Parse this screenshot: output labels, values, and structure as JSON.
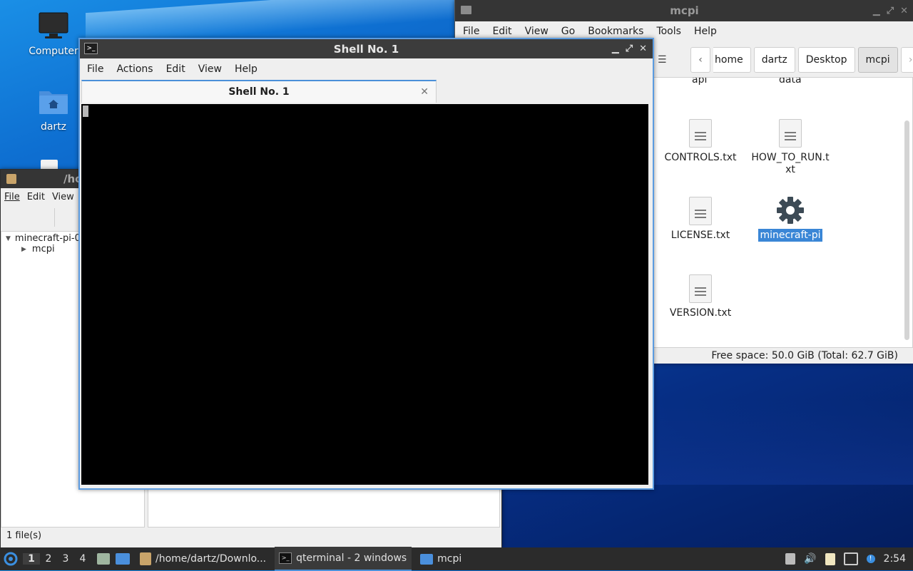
{
  "desktop": {
    "icons": [
      {
        "label": "Computer",
        "icon": "monitor-icon"
      },
      {
        "label": "dartz",
        "icon": "home-folder-icon"
      }
    ]
  },
  "archive_window": {
    "title": "/ho",
    "menu": [
      "File",
      "Edit",
      "View"
    ],
    "tree": [
      {
        "label": "minecraft-pi-0",
        "expanded": true
      },
      {
        "label": "mcpi",
        "expanded": false
      }
    ],
    "status": "1 file(s)"
  },
  "file_manager": {
    "title": "mcpi",
    "menu": [
      "File",
      "Edit",
      "View",
      "Go",
      "Bookmarks",
      "Tools",
      "Help"
    ],
    "breadcrumb": [
      "home",
      "dartz",
      "Desktop",
      "mcpi"
    ],
    "top_cut_items": [
      "api",
      "data"
    ],
    "files": [
      {
        "name": "CONTROLS.txt",
        "icon": "text-file-icon"
      },
      {
        "name": "HOW_TO_RUN.txt",
        "name_wrapped": [
          "HOW_TO_RUN.t",
          "xt"
        ],
        "icon": "text-file-icon"
      },
      {
        "name": "LICENSE.txt",
        "icon": "text-file-icon"
      },
      {
        "name": "minecraft-pi",
        "icon": "gear-icon",
        "selected": true
      },
      {
        "name": "VERSION.txt",
        "icon": "text-file-icon"
      }
    ],
    "status": "Free space: 50.0 GiB (Total: 62.7 GiB)"
  },
  "terminal": {
    "title": "Shell No. 1",
    "menu": [
      "File",
      "Actions",
      "Edit",
      "View",
      "Help"
    ],
    "tab_label": "Shell No. 1",
    "content": ""
  },
  "taskbar": {
    "workspaces": [
      "1",
      "2",
      "3",
      "4"
    ],
    "active_workspace": "1",
    "tasks": [
      {
        "label": "/home/dartz/Downlo...",
        "icon": "archive-icon"
      },
      {
        "label": "qterminal - 2 windows",
        "icon": "terminal-icon",
        "active": true
      },
      {
        "label": "mcpi",
        "icon": "folder-icon"
      }
    ],
    "clock": "2:54"
  },
  "colors": {
    "selection": "#3a86d6",
    "terminal_border": "#5b9be0",
    "taskbar_bg": "#2b2b2b"
  }
}
